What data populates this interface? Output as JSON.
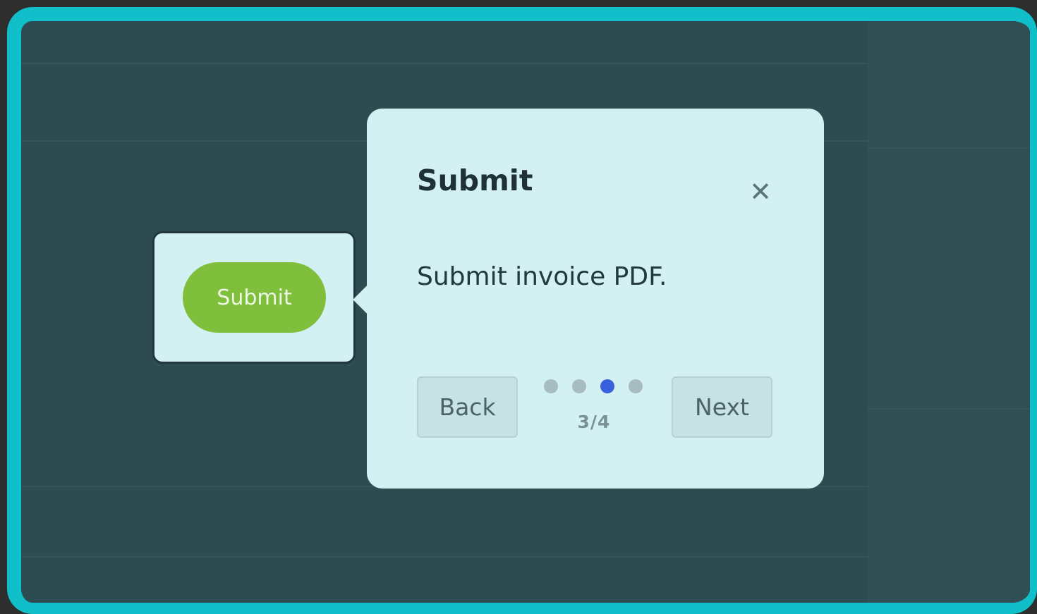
{
  "popover": {
    "title": "Submit",
    "body": "Submit invoice PDF.",
    "back_label": "Back",
    "next_label": "Next",
    "close_icon": "close-icon",
    "step_label": "3/4",
    "step_current": 3,
    "step_total": 4
  },
  "highlight": {
    "button_label": "Submit"
  },
  "colors": {
    "frame_border": "#10bfc9",
    "backdrop": "#2d4c52",
    "popover_bg": "#d3f0f2",
    "submit_button": "#7fbf3c",
    "active_dot": "#3960dc",
    "inactive_dot": "#a7bcbf"
  }
}
